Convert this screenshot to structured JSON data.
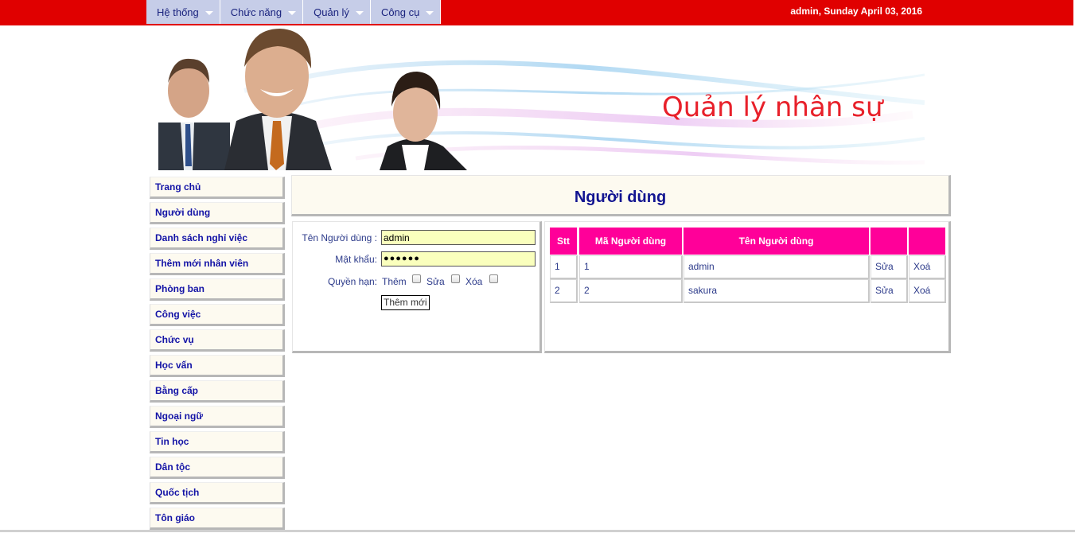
{
  "topmenu": {
    "items": [
      {
        "label": "Hệ thống"
      },
      {
        "label": "Chức năng"
      },
      {
        "label": "Quản lý"
      },
      {
        "label": "Công cụ"
      }
    ],
    "datetime": "admin, Sunday April 03, 2016"
  },
  "banner": {
    "title": "Quản lý nhân sự"
  },
  "sidebar": {
    "items": [
      {
        "label": "Trang chủ"
      },
      {
        "label": "Người dùng"
      },
      {
        "label": "Danh sách nghỉ việc"
      },
      {
        "label": "Thêm mới nhân viên"
      },
      {
        "label": "Phòng ban"
      },
      {
        "label": "Công việc"
      },
      {
        "label": "Chức vụ"
      },
      {
        "label": "Học vấn"
      },
      {
        "label": "Bằng cấp"
      },
      {
        "label": "Ngoại ngữ"
      },
      {
        "label": "Tin học"
      },
      {
        "label": "Dân tộc"
      },
      {
        "label": "Quốc tịch"
      },
      {
        "label": "Tôn giáo"
      }
    ]
  },
  "page": {
    "title": "Người dùng"
  },
  "form": {
    "username_label": "Tên Người dùng :",
    "username_value": "admin",
    "password_label": "Mật khẩu:",
    "password_value": "●●●●●●",
    "permission_label": "Quyền hạn:",
    "perm_add_label": "Thêm",
    "perm_edit_label": "Sửa",
    "perm_delete_label": "Xóa",
    "submit_label": "Thêm mới"
  },
  "table": {
    "headers": [
      "Stt",
      "Mã Người dùng",
      "Tên Người dùng",
      "",
      ""
    ],
    "rows": [
      {
        "stt": "1",
        "id": "1",
        "name": "admin",
        "edit": "Sửa",
        "delete": "Xoá"
      },
      {
        "stt": "2",
        "id": "2",
        "name": "sakura",
        "edit": "Sửa",
        "delete": "Xoá"
      }
    ]
  },
  "colors": {
    "topbar": "#e00000",
    "menu_bg": "#c6cde8",
    "header_pink": "#ff0099",
    "nav_text": "#1313a6",
    "panel_bg": "#fdfaf0"
  }
}
